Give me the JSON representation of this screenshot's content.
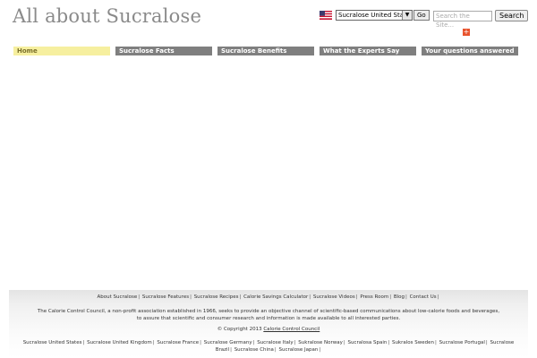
{
  "header": {
    "title": "All about Sucralose",
    "country_select_value": "Sucralose United States",
    "go_label": "Go",
    "search_placeholder": "Search the Site...",
    "search_label": "Search"
  },
  "nav": {
    "items": [
      {
        "label": "Home",
        "active": true
      },
      {
        "label": "Sucralose Facts",
        "active": false
      },
      {
        "label": "Sucralose Benefits",
        "active": false
      },
      {
        "label": "What the Experts Say",
        "active": false
      },
      {
        "label": "Your questions answered",
        "active": false
      }
    ]
  },
  "footer": {
    "links": [
      "About Sucralose",
      "Sucralose Features",
      "Sucralose Recipes",
      "Calorie Savings Calculator",
      "Sucralose Videos",
      "Press Room",
      "Blog",
      "Contact Us"
    ],
    "description_line1": "The Calorie Control Council, a non-profit association established in 1966, seeks to provide an objective channel of scientific-based communications about low-calorie foods and beverages,",
    "description_line2": "to assure that scientific and consumer research and information is made available to all interested parties.",
    "copyright": "© Copyright 2013",
    "council_link": "Calorie Control Council",
    "international": [
      "Sucralose United States",
      "Sucralose United Kingdom",
      "Sucralose France",
      "Sucralose Germany",
      "Sucralose Italy",
      "Sukralose Norway",
      "Sucralosa Spain",
      "Sukralos Sweden",
      "Sucralose Portugal",
      "Sucralose Brazil",
      "Sucralose China",
      "Sucralose Japan"
    ]
  },
  "colors": {
    "nav_bg": "#7f7f7f",
    "nav_active_bg": "#f6ef9f",
    "title": "#8a8a8a",
    "share_icon": "#e8532d"
  }
}
